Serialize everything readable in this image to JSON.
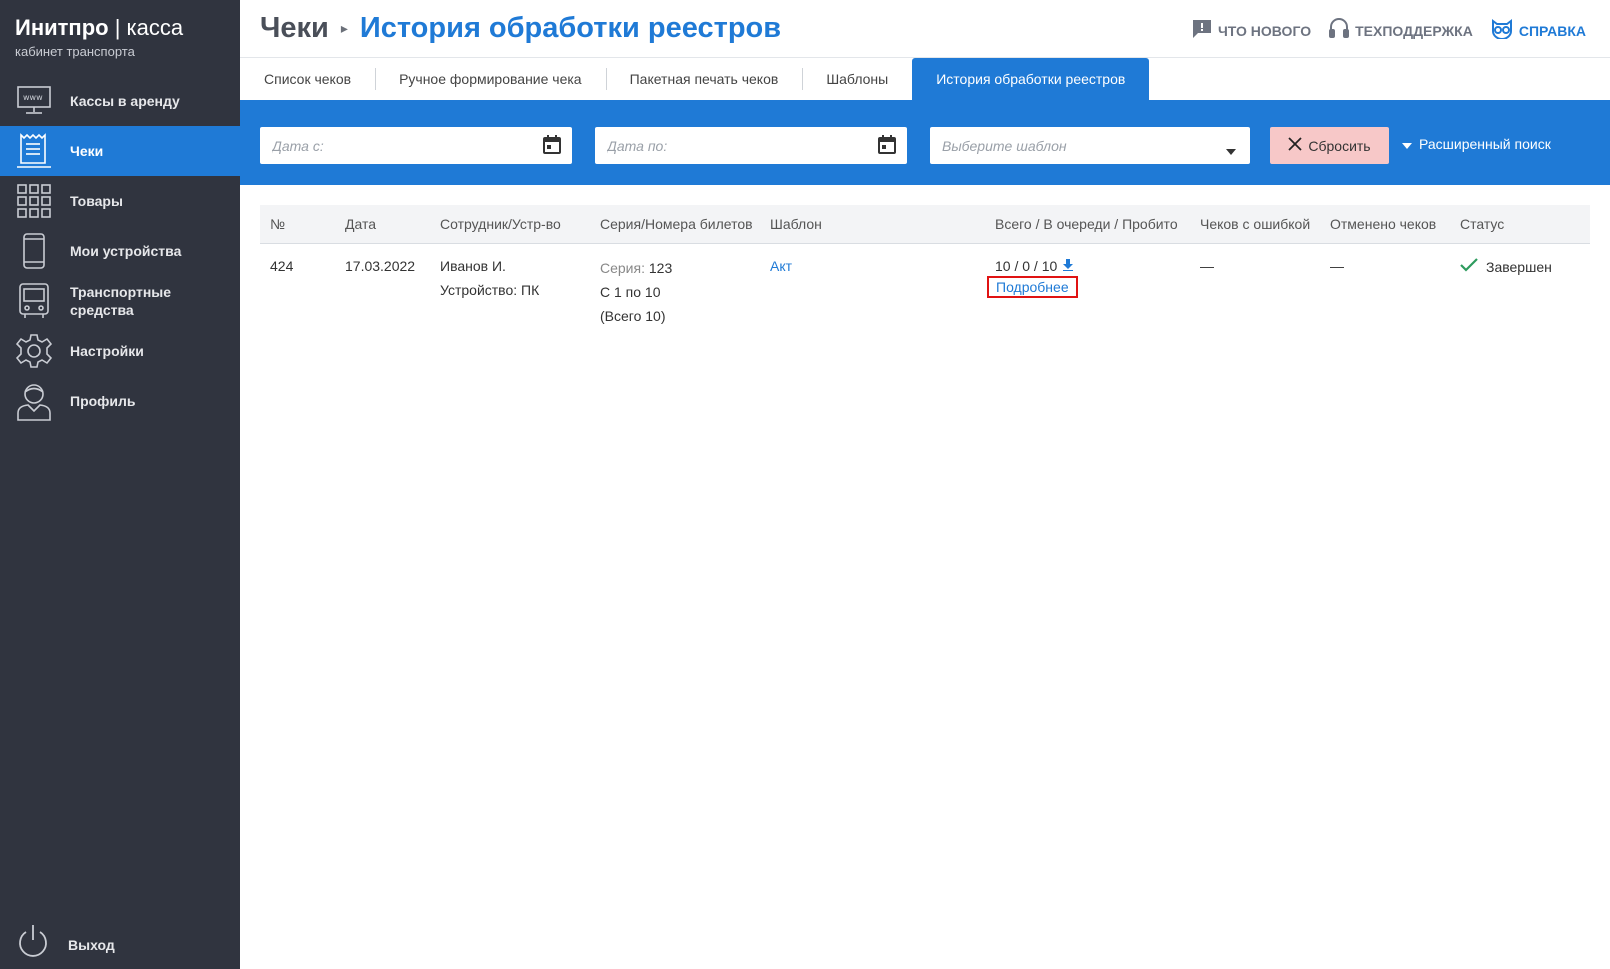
{
  "brand": {
    "name_bold": "Инитпро",
    "divider": "|",
    "name_light": "касса",
    "subtitle": "кабинет транспорта"
  },
  "sidebar": {
    "items": [
      {
        "label": "Кассы в аренду",
        "icon": "monitor-www-icon"
      },
      {
        "label": "Чеки",
        "icon": "receipt-icon",
        "active": true
      },
      {
        "label": "Товары",
        "icon": "grid-icon"
      },
      {
        "label": "Мои устройства",
        "icon": "phone-icon"
      },
      {
        "label": "Транспортные средства",
        "icon": "bus-icon"
      },
      {
        "label": "Настройки",
        "icon": "gear-icon"
      },
      {
        "label": "Профиль",
        "icon": "user-icon"
      }
    ],
    "logout": {
      "label": "Выход",
      "icon": "power-icon"
    }
  },
  "header": {
    "crumb_parent": "Чеки",
    "crumb_current": "История обработки реестров",
    "links": {
      "whats_new": "ЧТО НОВОГО",
      "support": "ТЕХПОДДЕРЖКА",
      "help": "СПРАВКА"
    }
  },
  "tabs": [
    {
      "label": "Список чеков"
    },
    {
      "label": "Ручное формирование чека"
    },
    {
      "label": "Пакетная печать чеков"
    },
    {
      "label": "Шаблоны"
    },
    {
      "label": "История обработки реестров",
      "active": true
    }
  ],
  "filters": {
    "date_from_placeholder": "Дата с:",
    "date_to_placeholder": "Дата по:",
    "template_placeholder": "Выберите шаблон",
    "reset_label": "Сбросить",
    "advanced_label": "Расширенный поиск"
  },
  "table": {
    "headers": [
      "№",
      "Дата",
      "Сотрудник/Устр-во",
      "Серия/Номера билетов",
      "Шаблон",
      "Всего / В очереди / Пробито",
      "Чеков с ошибкой",
      "Отменено чеков",
      "Статус"
    ],
    "rows": [
      {
        "number": "424",
        "date": "17.03.2022",
        "employee": "Иванов И.",
        "device": "Устройство: ПК",
        "series_label": "Серия:",
        "series_value": "123",
        "range": "С 1 по 10",
        "total": "(Всего 10)",
        "template": "Акт",
        "counts": "10 / 0 / 10",
        "details": "Подробнее",
        "errors": "—",
        "cancelled": "—",
        "status": "Завершен"
      }
    ]
  },
  "colors": {
    "sidebar_bg": "#30343f",
    "accent": "#1f7ad6",
    "reset_bg": "#f7c8c8",
    "status_ok": "#2e9b5e",
    "highlight": "#e01313"
  }
}
